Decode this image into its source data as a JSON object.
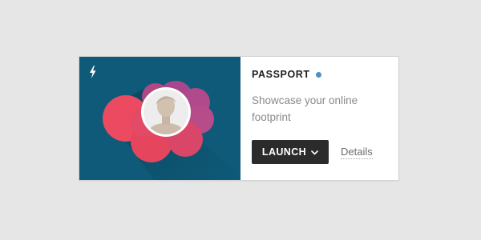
{
  "card": {
    "title": "PASSPORT",
    "description": "Showcase your online footprint",
    "launch_label": "LAUNCH",
    "details_label": "Details"
  },
  "icons": {
    "media_corner": "lightning-bolt-icon",
    "status": "status-dot",
    "launch_menu": "chevron-down-icon",
    "profile": "avatar-silhouette"
  },
  "colors": {
    "page_background": "#e6e6e6",
    "media_background": "#0e5a78",
    "status_dot": "#4a90c6",
    "launch_button": "#2b2b2b",
    "bubble_pink": "#e8475e",
    "bubble_purple": "#b5488a"
  }
}
